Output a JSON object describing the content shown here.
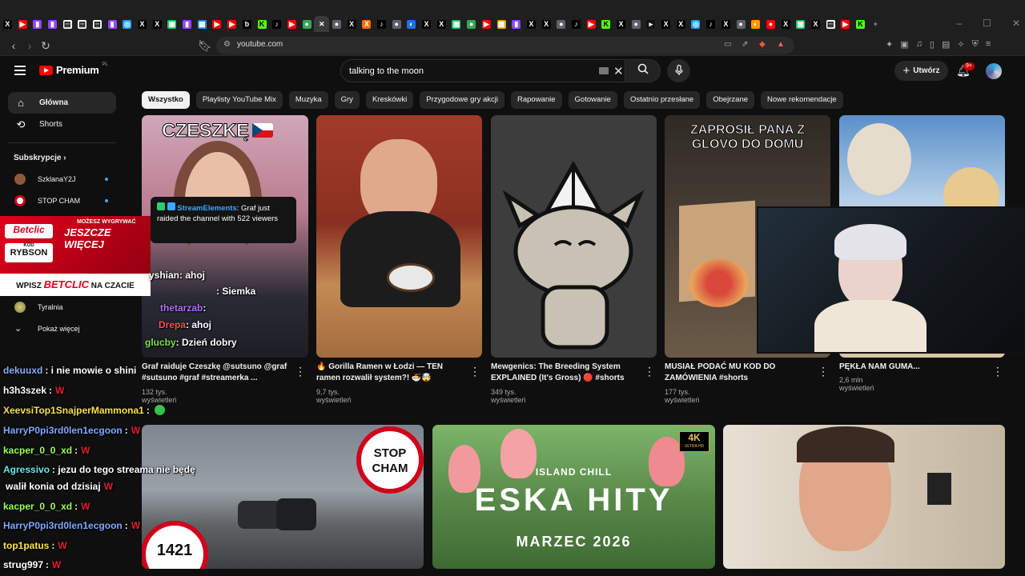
{
  "browser": {
    "tabs": [
      {
        "icon": "X",
        "color": "#000000",
        "fg": "#ffffff"
      },
      {
        "icon": "▶",
        "color": "#ff0000"
      },
      {
        "icon": "▮",
        "color": "#9146ff"
      },
      {
        "icon": "▮",
        "color": "#9146ff"
      },
      {
        "icon": "▤",
        "color": "#ffffff",
        "fg": "#000"
      },
      {
        "icon": "▤",
        "color": "#ffffff",
        "fg": "#000"
      },
      {
        "icon": "▤",
        "color": "#ffffff",
        "fg": "#000"
      },
      {
        "icon": "▮",
        "color": "#9146ff"
      },
      {
        "icon": "◎",
        "color": "#1da1f2"
      },
      {
        "icon": "X",
        "color": "#000000",
        "fg": "#ffffff"
      },
      {
        "icon": "X",
        "color": "#000000",
        "fg": "#ffffff"
      },
      {
        "icon": "▣",
        "color": "#21c46b"
      },
      {
        "icon": "▮",
        "color": "#9146ff"
      },
      {
        "icon": "▦",
        "color": "#1e90ff"
      },
      {
        "icon": "▶",
        "color": "#ff0000"
      },
      {
        "icon": "▶",
        "color": "#ff0000"
      },
      {
        "icon": "b",
        "color": "#000000",
        "fg": "#ffffff"
      },
      {
        "icon": "K",
        "color": "#53fc18",
        "fg": "#000"
      },
      {
        "icon": "♪",
        "color": "#000000",
        "fg": "#ffffff"
      },
      {
        "icon": "▶",
        "color": "#ff0000"
      },
      {
        "icon": "●",
        "color": "#34a853"
      },
      {
        "icon": "✕",
        "color": "#3a3a3a",
        "fg": "#ffffff",
        "active": true
      },
      {
        "icon": "●",
        "color": "#5f6368"
      },
      {
        "icon": "X",
        "color": "#000000",
        "fg": "#ffffff"
      },
      {
        "icon": "X",
        "color": "#ff6a00"
      },
      {
        "icon": "♪",
        "color": "#000000",
        "fg": "#ffffff"
      },
      {
        "icon": "●",
        "color": "#5f6368"
      },
      {
        "icon": "◐",
        "color": "#1a73e8"
      },
      {
        "icon": "X",
        "color": "#000000",
        "fg": "#ffffff"
      },
      {
        "icon": "X",
        "color": "#000000",
        "fg": "#ffffff"
      },
      {
        "icon": "▣",
        "color": "#21c46b"
      },
      {
        "icon": "●",
        "color": "#34a853"
      },
      {
        "icon": "▶",
        "color": "#ff0000"
      },
      {
        "icon": "▦",
        "color": "#e8a317"
      },
      {
        "icon": "▮",
        "color": "#9146ff"
      },
      {
        "icon": "X",
        "color": "#000000",
        "fg": "#ffffff"
      },
      {
        "icon": "X",
        "color": "#000000",
        "fg": "#ffffff"
      },
      {
        "icon": "●",
        "color": "#5f6368"
      },
      {
        "icon": "♪",
        "color": "#000000",
        "fg": "#ffffff"
      },
      {
        "icon": "▶",
        "color": "#ff0000"
      },
      {
        "icon": "K",
        "color": "#53fc18",
        "fg": "#000"
      },
      {
        "icon": "X",
        "color": "#000000",
        "fg": "#ffffff"
      },
      {
        "icon": "●",
        "color": "#5f6368"
      },
      {
        "icon": "▸",
        "color": "#111",
        "fg": "#fff"
      },
      {
        "icon": "X",
        "color": "#000000",
        "fg": "#ffffff"
      },
      {
        "icon": "X",
        "color": "#000000",
        "fg": "#ffffff"
      },
      {
        "icon": "◎",
        "color": "#1da1f2"
      },
      {
        "icon": "♪",
        "color": "#000000",
        "fg": "#ffffff"
      },
      {
        "icon": "X",
        "color": "#000000",
        "fg": "#ffffff"
      },
      {
        "icon": "●",
        "color": "#5f6368"
      },
      {
        "icon": "◐",
        "color": "#ff9800"
      },
      {
        "icon": "●",
        "color": "#ff0000"
      },
      {
        "icon": "X",
        "color": "#000000",
        "fg": "#ffffff"
      },
      {
        "icon": "▣",
        "color": "#21c46b"
      },
      {
        "icon": "X",
        "color": "#000000",
        "fg": "#ffffff"
      },
      {
        "icon": "▤",
        "color": "#ffffff",
        "fg": "#000"
      },
      {
        "icon": "▶",
        "color": "#ff0000"
      },
      {
        "icon": "K",
        "color": "#53fc18",
        "fg": "#000"
      },
      {
        "icon": "+",
        "color": "transparent",
        "fg": "#999"
      }
    ],
    "url": "youtube.com"
  },
  "header": {
    "logo_word": "Premium",
    "logo_cc": "PL",
    "search_query": "talking to the moon",
    "create_label": "Utwórz",
    "notif_count": "9+"
  },
  "sidebar": {
    "items": [
      {
        "label": "Główna",
        "icon": "home-icon",
        "glyph": "⌂",
        "active": true
      },
      {
        "label": "Shorts",
        "icon": "shorts-icon",
        "glyph": "⟲"
      }
    ],
    "subs_heading": "Subskrypcje",
    "subs": [
      {
        "label": "SzklanaY2J",
        "color": "#8c5a3c"
      },
      {
        "label": "STOP CHAM",
        "color": "#d0021b"
      }
    ],
    "tyralnia": "Tyralnia",
    "show_more": "Pokaż więcej"
  },
  "chips": [
    "Wszystko",
    "Playlisty YouTube Mix",
    "Muzyka",
    "Gry",
    "Kreskówki",
    "Przygodowe gry akcji",
    "Rapowanie",
    "Gotowanie",
    "Ostatnio przesłane",
    "Obejrzane",
    "Nowe rekomendacje"
  ],
  "videos": [
    {
      "title": "Graf raiduje Czeszkę @sutsuno @graf #sutsuno #graf #streamerka ...",
      "meta": "132 tys. wyświetleń",
      "thumb_text": "CZESZKĘ"
    },
    {
      "title": "🔥 Gorilla Ramen w Łodzi — TEN ramen rozwalił system?! 🍜🤯",
      "meta": "9,7 tys. wyświetleń"
    },
    {
      "title": "Mewgenics: The Breeding System EXPLAINED (It's Gross) 🔴 #shorts",
      "meta": "349 tys. wyświetleń"
    },
    {
      "title": "MUSIAŁ PODAĆ MU KOD DO ZAMÓWIENIA #shorts",
      "meta": "177 tys. wyświetleń",
      "thumb_text": "ZAPROSIŁ PANA Z GLOVO DO DOMU"
    },
    {
      "title": "PĘKŁA NAM GUMA...",
      "meta": "2,6 mln wyświetleń"
    }
  ],
  "row2": {
    "stopcham_badge": "STOP CHAM",
    "counter": "1421",
    "eska_top": "ISLAND CHILL",
    "eska_title": "ESKA HITY",
    "eska_sub": "MARZEC 2026",
    "badge_4k": "4K",
    "badge_4k_sub": "ULTRA HD"
  },
  "stream_alert": {
    "name": "StreamElements",
    "text": ": Graf just raided the channel with 522 viewers"
  },
  "betclic": {
    "top": "MOŻESZ WYGRYWAĆ",
    "headline": "JESZCZE WIĘCEJ",
    "brand": "Betclic",
    "code_label": "KOD",
    "code": "RYBSON",
    "cta_pre": "WPISZ",
    "cta_brand": "BETCLIC",
    "cta_post": "NA CZACIE"
  },
  "chat_upper": [
    {
      "user": "yshian",
      "msg": ": ahoj",
      "color": "#ffffff"
    },
    {
      "user": "",
      "msg": ": Siemka",
      "color": "#ffffff"
    },
    {
      "user": "thetarzab",
      "msg": ":",
      "color": "#b070ff"
    },
    {
      "user": "Drepa",
      "msg": ": ahoj",
      "color": "#ff4d4d"
    },
    {
      "user": "glucby",
      "msg": ": Dzień dobry",
      "color": "#7fdd4c"
    }
  ],
  "chat": [
    {
      "user": "dekuuxd",
      "msg": ": i nie mowie o shini",
      "color": "#87b0ff"
    },
    {
      "user": "h3h3szek",
      "msg": ":",
      "color": "#ffffff",
      "w": true
    },
    {
      "user": "XeevsiTop1SnajperMammona1",
      "msg": ":",
      "color": "#f5e34a",
      "emote": true
    },
    {
      "user": "HarryP0pi3rd0len1ecgoon",
      "msg": ":",
      "color": "#7fa8ff",
      "w": true
    },
    {
      "user": "kacper_0_0_xd",
      "msg": ":",
      "color": "#9cff57",
      "w": true
    },
    {
      "user": "Agressivo",
      "msg": ": jezu do tego streama nie będę",
      "color": "#6ee7e7"
    },
    {
      "user": "",
      "msg": "walił konia od dzisiaj",
      "color": "#ffffff",
      "w": true
    },
    {
      "user": "kacper_0_0_xd",
      "msg": ":",
      "color": "#9cff57",
      "w": true
    },
    {
      "user": "HarryP0pi3rd0len1ecgoon",
      "msg": ":",
      "color": "#7fa8ff",
      "w": true
    },
    {
      "user": "top1patus",
      "msg": ":",
      "color": "#ffe14a",
      "w": true
    },
    {
      "user": "strug997",
      "msg": ":",
      "color": "#ffffff",
      "w": true
    }
  ]
}
